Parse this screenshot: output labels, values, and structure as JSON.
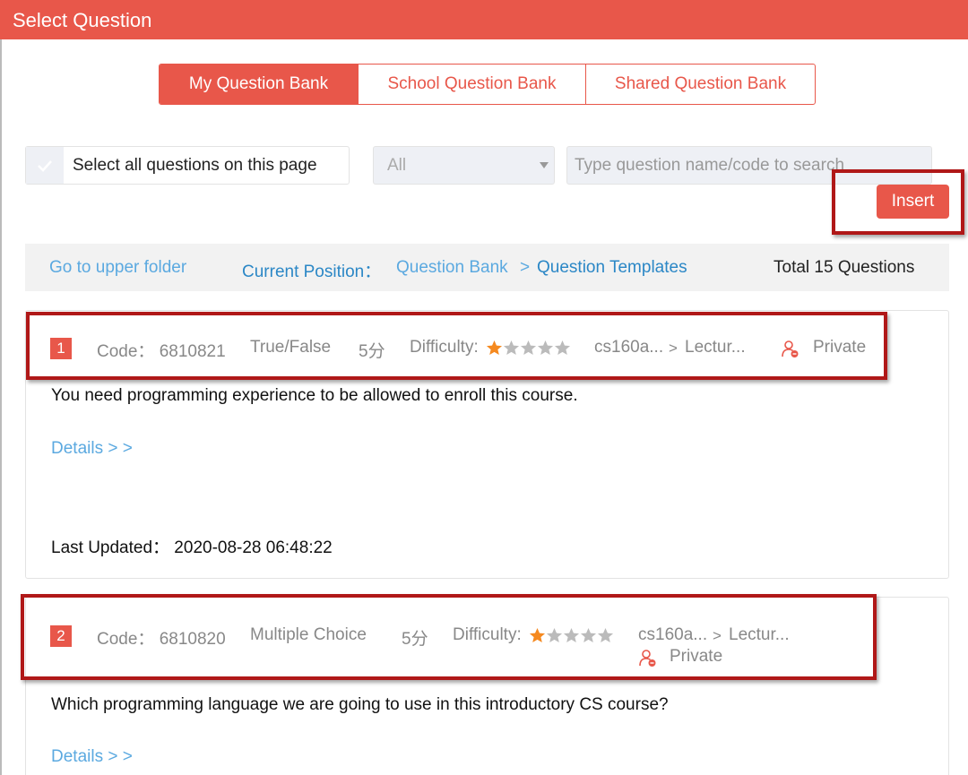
{
  "window": {
    "title": "Select Question"
  },
  "tabs": [
    {
      "label": "My Question Bank",
      "active": true
    },
    {
      "label": "School Question Bank",
      "active": false
    },
    {
      "label": "Shared Question Bank",
      "active": false
    }
  ],
  "toolbar": {
    "select_all_label": "Select all questions on this page",
    "filter_value": "All",
    "search_placeholder": "Type question name/code to search",
    "insert_label": "Insert"
  },
  "path": {
    "upper_folder": "Go to upper folder",
    "current_position_label": "Current Position：",
    "crumb_root": "Question Bank",
    "crumb_sep": ">",
    "crumb_current": "Question Templates",
    "total": "Total 15 Questions"
  },
  "questions": [
    {
      "number": "1",
      "code": "Code： 6810821",
      "type": "True/False",
      "score": "5分",
      "difficulty_label": "Difficulty:",
      "difficulty_stars": 1,
      "difficulty_max": 5,
      "folder": "cs160a...",
      "folder_sep": ">",
      "subfolder": "Lectur...",
      "visibility": "Private",
      "text": "You need programming experience to be allowed to enroll this course.",
      "details": "Details > >",
      "last_updated": "Last Updated： 2020-08-28 06:48:22"
    },
    {
      "number": "2",
      "code": "Code： 6810820",
      "type": "Multiple Choice",
      "score": "5分",
      "difficulty_label": "Difficulty:",
      "difficulty_stars": 1,
      "difficulty_max": 5,
      "folder": "cs160a...",
      "folder_sep": ">",
      "subfolder": "Lectur...",
      "visibility": "Private",
      "text": "Which programming language we are going to use in this introductory CS course?",
      "details": "Details > >"
    }
  ],
  "icons": {
    "check": "check-icon",
    "dropdown": "chevron-down-icon",
    "star": "star-icon",
    "private": "private-user-icon"
  },
  "colors": {
    "accent": "#e8574a",
    "link": "#5ba9e0",
    "link_dark": "#2b87c6",
    "star_on": "#f5891f",
    "star_off": "#bbbbbb",
    "annotation": "#b01818"
  }
}
